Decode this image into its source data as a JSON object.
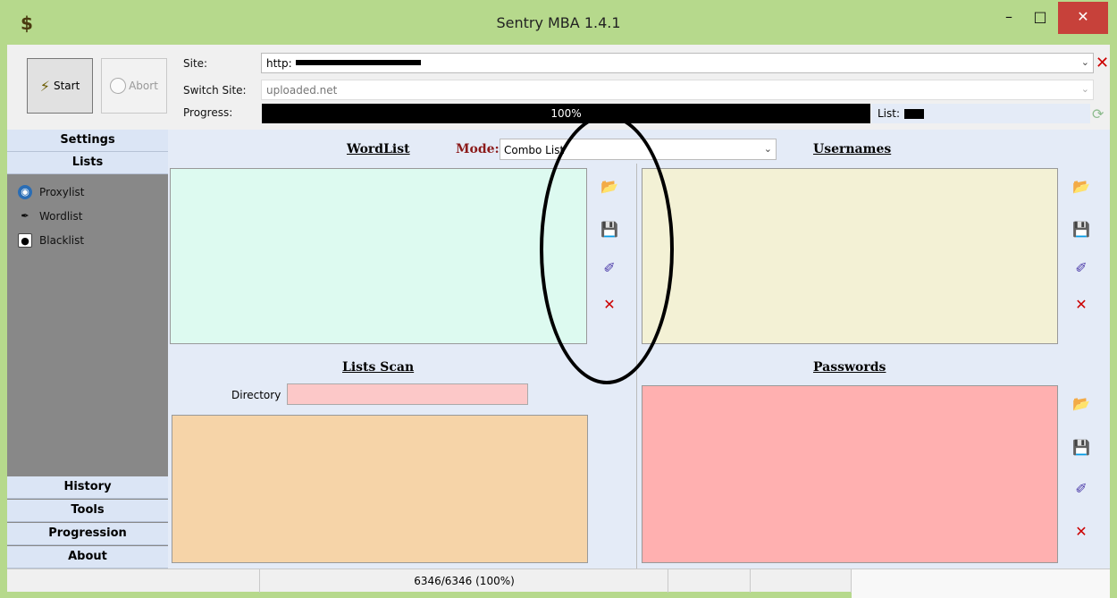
{
  "window": {
    "title": "Sentry MBA 1.4.1",
    "min_glyph": "–",
    "max_glyph": "□",
    "close_glyph": "✕"
  },
  "controls": {
    "start_label": "Start",
    "abort_label": "Abort",
    "site_label": "Site:",
    "site_value": "http:",
    "switch_site_label": "Switch Site:",
    "switch_site_value": "uploaded.net",
    "progress_label": "Progress:",
    "progress_value": 100,
    "progress_text": "100%",
    "list_label": "List:"
  },
  "nav": {
    "settings": "Settings",
    "lists": "Lists",
    "items": [
      {
        "label": "Proxylist",
        "icon": "globe-icon"
      },
      {
        "label": "Wordlist",
        "icon": "feather-icon"
      },
      {
        "label": "Blacklist",
        "icon": "eye-icon"
      }
    ],
    "history": "History",
    "tools": "Tools",
    "progression": "Progression",
    "about": "About"
  },
  "main": {
    "wordlist_title": "WordList",
    "mode_label": "Mode:",
    "mode_value": "Combo List",
    "usernames_title": "Usernames",
    "lists_scan_title": "Lists Scan",
    "directory_label": "Directory",
    "passwords_title": "Passwords"
  },
  "icons": {
    "open": "folder-open-icon",
    "save": "floppy-disk-icon",
    "clear": "broom-icon",
    "delete": "delete-icon"
  },
  "status": {
    "count": "6346/6346 (100%)"
  },
  "colors": {
    "title_bar": "#b6d98c",
    "nav_background": "#888888",
    "wordlist_bg": "#ddfaf0",
    "usernames_bg": "#f3f1d5",
    "lists_scan_bg": "#f6d4a8",
    "passwords_bg": "#ffb0b0",
    "close_button": "#c7413a"
  }
}
